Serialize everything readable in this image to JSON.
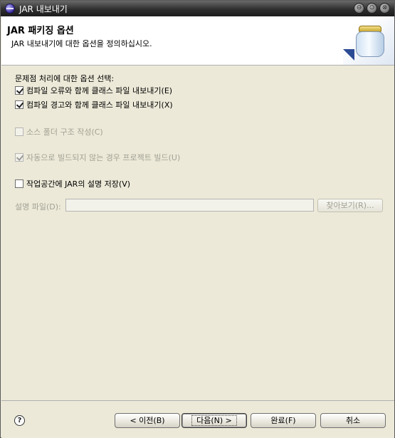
{
  "window": {
    "title": "JAR 내보내기",
    "controls": [
      "⊖",
      "⊙",
      "⊗"
    ]
  },
  "banner": {
    "title": "JAR 패키징 옵션",
    "description": "JAR 내보내기에 대한 옵션을 정의하십시오."
  },
  "options": {
    "problems_label": "문제점 처리에 대한 옵션 선택:",
    "export_errors": {
      "label": "컴파일 오류와 함께 클래스 파일 내보내기(E)",
      "checked": true,
      "enabled": true
    },
    "export_warnings": {
      "label": "컴파일 경고와 함께 클래스 파일 내보내기(X)",
      "checked": true,
      "enabled": true
    },
    "create_source_folders": {
      "label": "소스 폴더 구조 작성(C)",
      "checked": false,
      "enabled": false
    },
    "build_projects": {
      "label": "자동으로 빌드되지 않는 경우 프로젝트 빌드(U)",
      "checked": true,
      "enabled": false
    },
    "save_description": {
      "label": "작업공간에 JAR의 설명 저장(V)",
      "checked": false,
      "enabled": true
    },
    "description_file_label": "설명 파일(D):",
    "description_file_value": "",
    "browse_label": "찾아보기(R)..."
  },
  "footer": {
    "help_symbol": "?",
    "back_label": "< 이전(B)",
    "next_label": "다음(N) >",
    "finish_label": "완료(F)",
    "cancel_label": "취소"
  }
}
